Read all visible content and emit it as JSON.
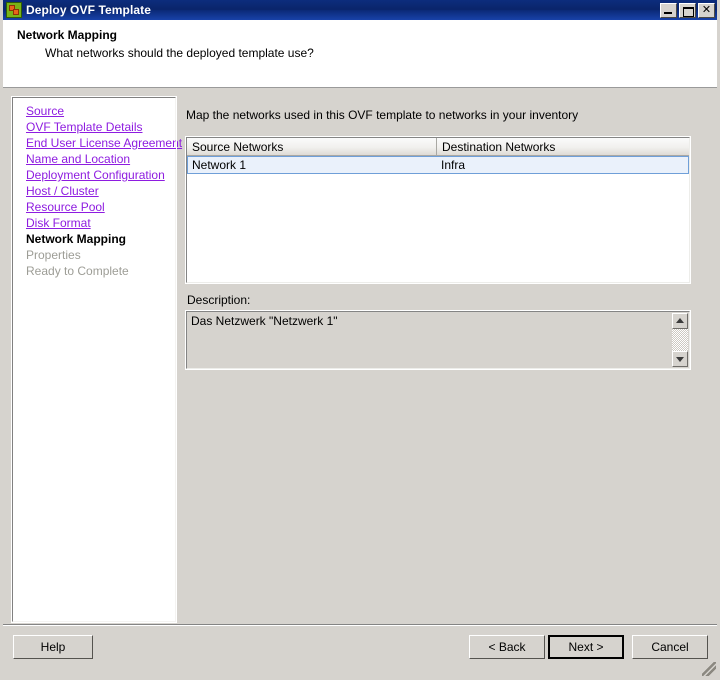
{
  "window": {
    "title": "Deploy OVF Template",
    "icon": "ovf-template-icon",
    "controls": {
      "minimize": "minimize-icon",
      "maximize": "maximize-icon",
      "close": "✕"
    }
  },
  "header": {
    "title": "Network Mapping",
    "subtitle": "What networks should the deployed template use?"
  },
  "sidebar": {
    "items": [
      {
        "label": "Source",
        "state": "link"
      },
      {
        "label": "OVF Template Details",
        "state": "link"
      },
      {
        "label": "End User License Agreement",
        "state": "link"
      },
      {
        "label": "Name and Location",
        "state": "link"
      },
      {
        "label": "Deployment Configuration",
        "state": "link"
      },
      {
        "label": "Host / Cluster",
        "state": "link"
      },
      {
        "label": "Resource Pool",
        "state": "link"
      },
      {
        "label": "Disk Format",
        "state": "link"
      },
      {
        "label": "Network Mapping",
        "state": "current"
      },
      {
        "label": "Properties",
        "state": "future"
      },
      {
        "label": "Ready to Complete",
        "state": "future"
      }
    ],
    "link_color": "#8e1ce0",
    "current_color": "#000000",
    "future_color": "#9d9d96"
  },
  "main": {
    "instruction": "Map the networks used in this OVF template to networks in your inventory",
    "table": {
      "columns": [
        "Source Networks",
        "Destination Networks"
      ],
      "rows": [
        {
          "source": "Network 1",
          "destination": "Infra",
          "selected": true
        }
      ],
      "selected_row_bg": "#eaf1fb",
      "selected_row_border": "#6f9fd8"
    },
    "description": {
      "label": "Description:",
      "text": "Das Netzwerk \"Netzwerk 1\"",
      "scroll_up": "scroll-up-arrow",
      "scroll_down": "scroll-down-arrow"
    }
  },
  "footer": {
    "help": "Help",
    "back": "< Back",
    "next": "Next >",
    "cancel": "Cancel",
    "default_button": "Next >"
  },
  "colors": {
    "titlebar": "#0a246a",
    "dialog_bg": "#d6d3ce",
    "panel_bg": "#ffffff"
  }
}
